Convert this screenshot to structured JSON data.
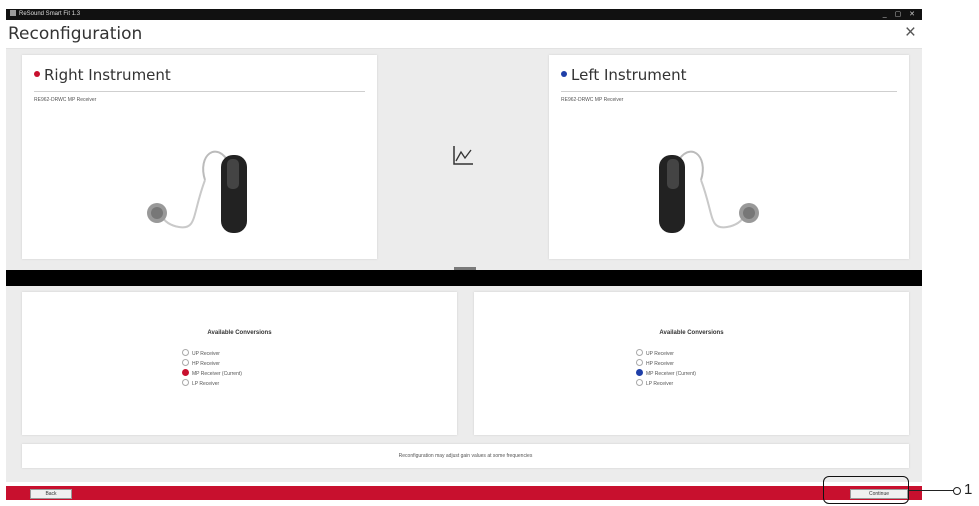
{
  "window": {
    "title": "ReSound Smart Fit 1.3",
    "controls": "_ ▢ ✕"
  },
  "header": {
    "title": "Reconfiguration",
    "close_glyph": "×"
  },
  "right_instrument": {
    "title": "Right Instrument",
    "model": "RE962-DRWC MP Receiver",
    "dot_color": "#c8102e"
  },
  "left_instrument": {
    "title": "Left Instrument",
    "model": "RE962-DRWC MP Receiver",
    "dot_color": "#1f3fa8"
  },
  "graph_icon": "line-chart-icon",
  "right_conversions": {
    "heading": "Available Conversions",
    "options": [
      "UP Receiver",
      "HP Receiver",
      "MP Receiver (Current)",
      "LP Receiver"
    ],
    "selected": "MP Receiver (Current)"
  },
  "left_conversions": {
    "heading": "Available Conversions",
    "options": [
      "UP Receiver",
      "HP Receiver",
      "MP Receiver (Current)",
      "LP Receiver"
    ],
    "selected": "MP Receiver (Current)"
  },
  "note": "Reconfiguration may adjust gain values at some frequencies",
  "footer": {
    "back_label": "Back",
    "continue_label": "Continue"
  },
  "callout": {
    "number": "1"
  },
  "colors": {
    "accent": "#c8102e",
    "left_accent": "#1f3fa8",
    "splitter": "#000000"
  }
}
